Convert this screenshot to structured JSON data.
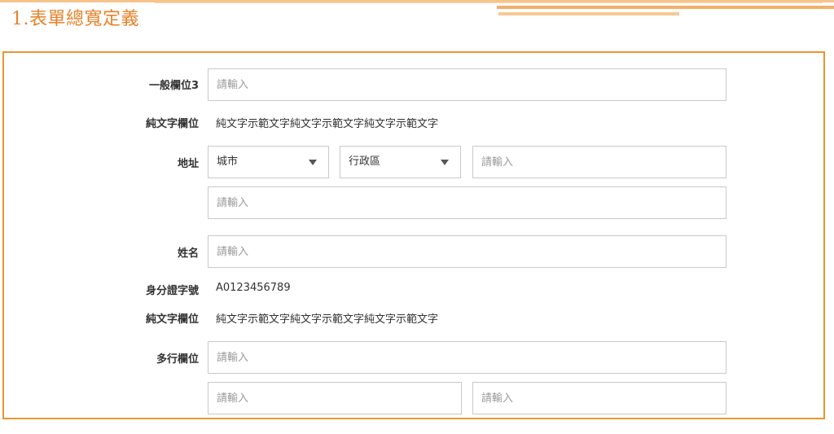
{
  "page": {
    "title": "1.表單總寬定義"
  },
  "form": {
    "general_field": {
      "label": "一般欄位3",
      "placeholder": "請輸入"
    },
    "text_field_1": {
      "label": "純文字欄位",
      "value": "純文字示範文字純文字示範文字純文字示範文字"
    },
    "address": {
      "label": "地址",
      "city": {
        "value": "城市"
      },
      "district": {
        "value": "行政區"
      },
      "detail_placeholder": "請輸入",
      "street_placeholder": "請輸入"
    },
    "name": {
      "label": "姓名",
      "placeholder": "請輸入"
    },
    "id_number": {
      "label": "身分證字號",
      "value": "A0123456789"
    },
    "text_field_2": {
      "label": "純文字欄位",
      "value": "純文字示範文字純文字示範文字純文字示範文字"
    },
    "multi_field": {
      "label": "多行欄位",
      "row1_placeholder": "請輸入",
      "row2_left_placeholder": "請輸入",
      "row2_right_placeholder": "請輸入"
    }
  },
  "colors": {
    "accent": "#e8822a",
    "border": "#e8952f",
    "input_border": "#c9c9c9"
  }
}
